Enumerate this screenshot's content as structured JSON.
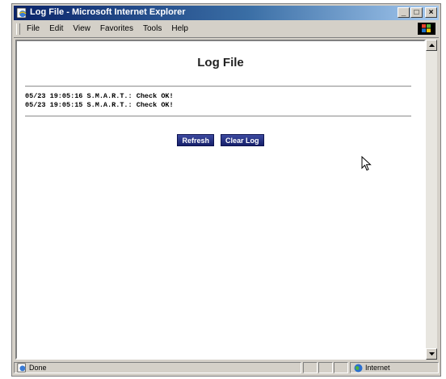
{
  "window": {
    "title": "Log File - Microsoft Internet Explorer",
    "minimize_glyph": "_",
    "maximize_glyph": "□",
    "close_glyph": "×"
  },
  "menu": {
    "items": [
      "File",
      "Edit",
      "View",
      "Favorites",
      "Tools",
      "Help"
    ]
  },
  "page": {
    "title": "Log File",
    "log_lines": [
      "05/23 19:05:16 S.M.A.R.T.: Check OK!",
      "05/23 19:05:15 S.M.A.R.T.: Check OK!"
    ],
    "refresh_label": "Refresh",
    "clear_log_label": "Clear Log"
  },
  "status": {
    "text": "Done",
    "zone": "Internet"
  },
  "icons": {
    "app": "ie-page-icon",
    "brand": "windows-flag-logo",
    "status": "ie-page-icon",
    "zone": "internet-globe-icon",
    "cursor": "mouse-pointer-icon"
  },
  "colors": {
    "title_bar": "#0a246a",
    "button": "#1f2a7a"
  }
}
